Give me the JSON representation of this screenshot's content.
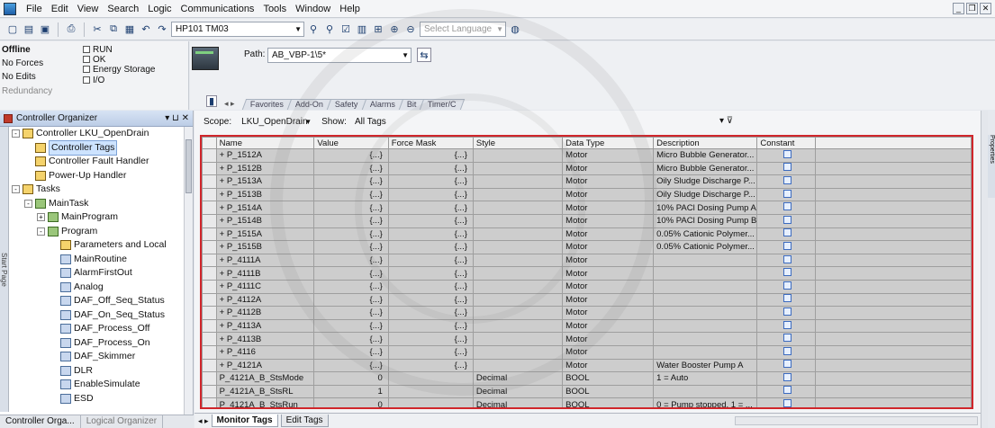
{
  "menu": [
    "File",
    "Edit",
    "View",
    "Search",
    "Logic",
    "Communications",
    "Tools",
    "Window",
    "Help"
  ],
  "toolbar": {
    "project_combo": "HP101 TM03",
    "language_placeholder": "Select Language"
  },
  "status": {
    "offline": "Offline",
    "forces": "No Forces",
    "edits": "No Edits",
    "redundancy": "Redundancy",
    "run": "RUN",
    "ok": "OK",
    "energy": "Energy Storage",
    "io": "I/O"
  },
  "path": {
    "label": "Path:",
    "value": "AB_VBP-1\\5*"
  },
  "instr_tabs": [
    "Favorites",
    "Add-On",
    "Safety",
    "Alarms",
    "Bit",
    "Timer/C"
  ],
  "organizer": {
    "title": "Controller Organizer",
    "side_tab": "Start Page",
    "tree": [
      {
        "label": "Controller LKU_OpenDrain",
        "level": 0,
        "toggle": "-",
        "icon": "folder"
      },
      {
        "label": "Controller Tags",
        "level": 1,
        "toggle": "",
        "icon": "tags",
        "selected": true
      },
      {
        "label": "Controller Fault Handler",
        "level": 1,
        "toggle": "",
        "icon": "folder"
      },
      {
        "label": "Power-Up Handler",
        "level": 1,
        "toggle": "",
        "icon": "folder"
      },
      {
        "label": "Tasks",
        "level": 0,
        "toggle": "-",
        "icon": "folder"
      },
      {
        "label": "MainTask",
        "level": 1,
        "toggle": "-",
        "icon": "task"
      },
      {
        "label": "MainProgram",
        "level": 2,
        "toggle": "+",
        "icon": "program"
      },
      {
        "label": "Program",
        "level": 2,
        "toggle": "-",
        "icon": "program"
      },
      {
        "label": "Parameters and Local",
        "level": 3,
        "toggle": "",
        "icon": "tags"
      },
      {
        "label": "MainRoutine",
        "level": 3,
        "toggle": "",
        "icon": "routine"
      },
      {
        "label": "AlarmFirstOut",
        "level": 3,
        "toggle": "",
        "icon": "routine"
      },
      {
        "label": "Analog",
        "level": 3,
        "toggle": "",
        "icon": "routine"
      },
      {
        "label": "DAF_Off_Seq_Status",
        "level": 3,
        "toggle": "",
        "icon": "routine"
      },
      {
        "label": "DAF_On_Seq_Status",
        "level": 3,
        "toggle": "",
        "icon": "routine"
      },
      {
        "label": "DAF_Process_Off",
        "level": 3,
        "toggle": "",
        "icon": "routine"
      },
      {
        "label": "DAF_Process_On",
        "level": 3,
        "toggle": "",
        "icon": "routine"
      },
      {
        "label": "DAF_Skimmer",
        "level": 3,
        "toggle": "",
        "icon": "routine"
      },
      {
        "label": "DLR",
        "level": 3,
        "toggle": "",
        "icon": "routine"
      },
      {
        "label": "EnableSimulate",
        "level": 3,
        "toggle": "",
        "icon": "routine"
      },
      {
        "label": "ESD",
        "level": 3,
        "toggle": "",
        "icon": "routine"
      }
    ],
    "tabs": [
      "Controller Orga...",
      "Logical Organizer"
    ]
  },
  "editor": {
    "scope_label": "Scope:",
    "scope_value": "LKU_OpenDrain",
    "show_label": "Show:",
    "show_value": "All Tags",
    "columns": [
      "Name",
      "Value",
      "Force Mask",
      "Style",
      "Data Type",
      "Description",
      "Constant"
    ],
    "rows": [
      {
        "name": "+ P_1512A",
        "value": "{...}",
        "force": "{...}",
        "style": "",
        "type": "Motor",
        "desc": "Micro Bubble Generator..."
      },
      {
        "name": "+ P_1512B",
        "value": "{...}",
        "force": "{...}",
        "style": "",
        "type": "Motor",
        "desc": "Micro Bubble Generator..."
      },
      {
        "name": "+ P_1513A",
        "value": "{...}",
        "force": "{...}",
        "style": "",
        "type": "Motor",
        "desc": "Oily Sludge Discharge P..."
      },
      {
        "name": "+ P_1513B",
        "value": "{...}",
        "force": "{...}",
        "style": "",
        "type": "Motor",
        "desc": "Oily Sludge Discharge P..."
      },
      {
        "name": "+ P_1514A",
        "value": "{...}",
        "force": "{...}",
        "style": "",
        "type": "Motor",
        "desc": "10% PACl Dosing Pump A"
      },
      {
        "name": "+ P_1514B",
        "value": "{...}",
        "force": "{...}",
        "style": "",
        "type": "Motor",
        "desc": "10% PACl Dosing Pump B"
      },
      {
        "name": "+ P_1515A",
        "value": "{...}",
        "force": "{...}",
        "style": "",
        "type": "Motor",
        "desc": "0.05% Cationic Polymer..."
      },
      {
        "name": "+ P_1515B",
        "value": "{...}",
        "force": "{...}",
        "style": "",
        "type": "Motor",
        "desc": "0.05% Cationic Polymer..."
      },
      {
        "name": "+ P_4111A",
        "value": "{...}",
        "force": "{...}",
        "style": "",
        "type": "Motor",
        "desc": ""
      },
      {
        "name": "+ P_4111B",
        "value": "{...}",
        "force": "{...}",
        "style": "",
        "type": "Motor",
        "desc": ""
      },
      {
        "name": "+ P_4111C",
        "value": "{...}",
        "force": "{...}",
        "style": "",
        "type": "Motor",
        "desc": ""
      },
      {
        "name": "+ P_4112A",
        "value": "{...}",
        "force": "{...}",
        "style": "",
        "type": "Motor",
        "desc": ""
      },
      {
        "name": "+ P_4112B",
        "value": "{...}",
        "force": "{...}",
        "style": "",
        "type": "Motor",
        "desc": ""
      },
      {
        "name": "+ P_4113A",
        "value": "{...}",
        "force": "{...}",
        "style": "",
        "type": "Motor",
        "desc": ""
      },
      {
        "name": "+ P_4113B",
        "value": "{...}",
        "force": "{...}",
        "style": "",
        "type": "Motor",
        "desc": ""
      },
      {
        "name": "+ P_4116",
        "value": "{...}",
        "force": "{...}",
        "style": "",
        "type": "Motor",
        "desc": ""
      },
      {
        "name": "+ P_4121A",
        "value": "{...}",
        "force": "{...}",
        "style": "",
        "type": "Motor",
        "desc": "Water Booster Pump A"
      },
      {
        "name": "P_4121A_B_StsMode",
        "value": "0",
        "force": "",
        "style": "Decimal",
        "type": "BOOL",
        "desc": "1 = Auto"
      },
      {
        "name": "P_4121A_B_StsRL",
        "value": "1",
        "force": "",
        "style": "Decimal",
        "type": "BOOL",
        "desc": ""
      },
      {
        "name": "P_4121A_B_StsRun",
        "value": "0",
        "force": "",
        "style": "Decimal",
        "type": "BOOL",
        "desc": "0 = Pump stopped, 1 = ..."
      }
    ],
    "bottom_tabs": [
      "Monitor Tags",
      "Edit Tags"
    ]
  },
  "right_tab": "Properties"
}
